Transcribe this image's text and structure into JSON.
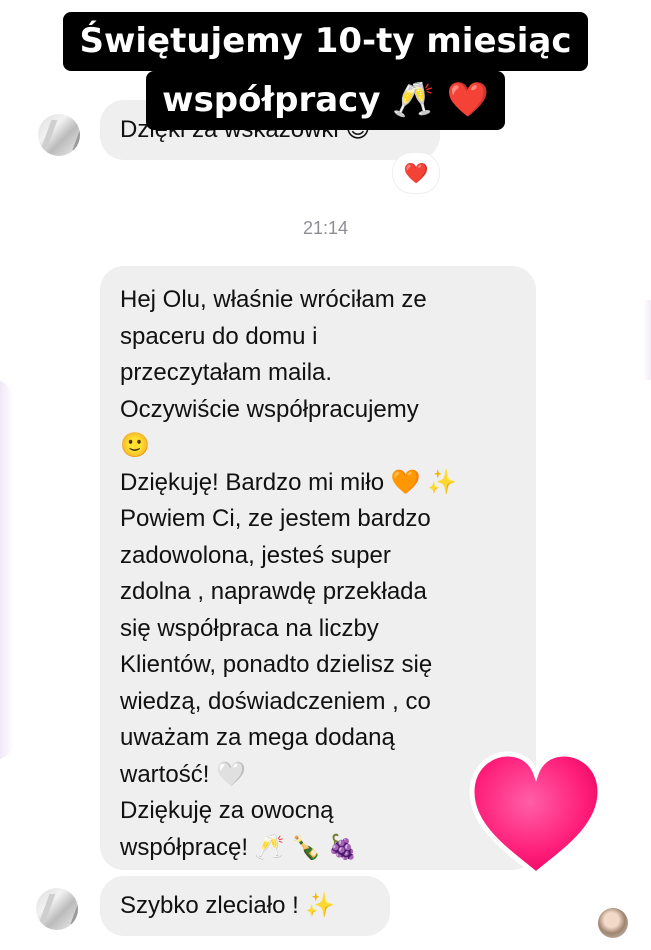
{
  "caption": {
    "line1": "Świętujemy 10-ty miesiąc",
    "line2": "współpracy 🥂 ❤️"
  },
  "thread": {
    "previous_message": "Dzięki za wskazówki 😊",
    "previous_reaction": "❤️",
    "timestamp": "21:14",
    "main_message_lines": [
      "Hej Olu, właśnie wróciłam ze",
      "spaceru do domu i",
      "przeczytałam maila.",
      "Oczywiście współpracujemy",
      "🙂",
      "Dziękuję! Bardzo mi miło 🧡 ✨",
      "Powiem Ci, ze jestem bardzo",
      "zadowolona, jesteś super",
      "zdolna , naprawdę przekłada",
      "się współpraca na liczby",
      "Klientów, ponadto dzielisz się",
      "wiedzą, doświadczeniem , co",
      "uważam za mega dodaną",
      "wartość! 🤍",
      "Dziękuję za owocną",
      "współpracę!  🥂 🍾 🍇"
    ],
    "last_message": "Szybko zleciało ! ✨"
  },
  "sticker": {
    "icon": "heart-sticker-icon",
    "color": "#ff1f7a"
  },
  "colors": {
    "bubble": "#efeff0",
    "caption_bg": "#000000",
    "timestamp": "#8e8e93"
  }
}
